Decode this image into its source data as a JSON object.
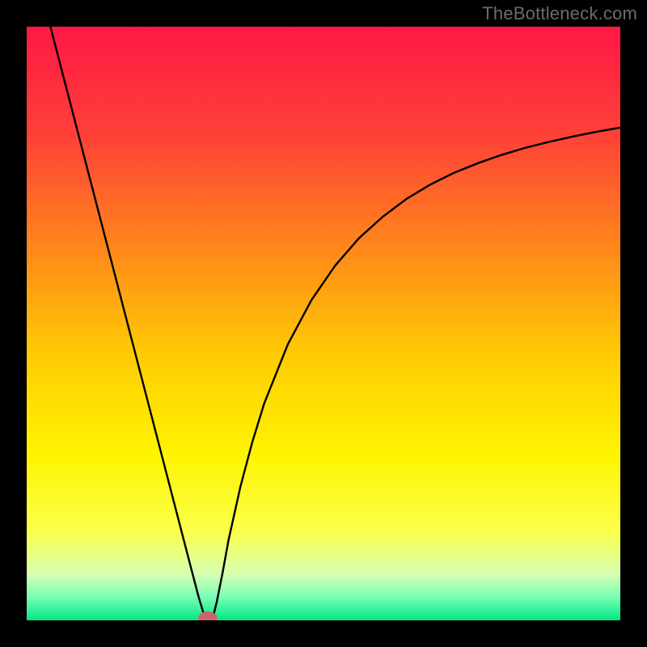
{
  "watermark": "TheBottleneck.com",
  "chart_data": {
    "type": "line",
    "title": "",
    "xlabel": "",
    "ylabel": "",
    "xlim": [
      0,
      100
    ],
    "ylim": [
      0,
      100
    ],
    "legend": false,
    "grid": false,
    "background_gradient_stops": [
      {
        "pct": 0,
        "color": "#ff1844"
      },
      {
        "pct": 18,
        "color": "#ff4038"
      },
      {
        "pct": 38,
        "color": "#ff8a1a"
      },
      {
        "pct": 55,
        "color": "#ffca04"
      },
      {
        "pct": 72,
        "color": "#fff400"
      },
      {
        "pct": 85,
        "color": "#fbff4a"
      },
      {
        "pct": 92,
        "color": "#d9ffb0"
      },
      {
        "pct": 96,
        "color": "#7cffb6"
      },
      {
        "pct": 100,
        "color": "#00e884"
      }
    ],
    "series": [
      {
        "name": "bottleneck-curve",
        "color": "#000000",
        "x": [
          4.0,
          6.0,
          8.0,
          10.0,
          12.0,
          14.0,
          16.0,
          18.0,
          20.0,
          22.0,
          24.0,
          26.0,
          28.0,
          29.0,
          30.0,
          30.5,
          31.0,
          31.5,
          32.0,
          33.0,
          34.0,
          36.0,
          38.0,
          40.0,
          44.0,
          48.0,
          52.0,
          56.0,
          60.0,
          64.0,
          68.0,
          72.0,
          76.0,
          80.0,
          84.0,
          88.0,
          92.0,
          96.0,
          100.0
        ],
        "y": [
          100.0,
          92.3,
          84.6,
          76.9,
          69.2,
          61.5,
          53.8,
          46.1,
          38.4,
          30.7,
          23.0,
          15.3,
          7.6,
          3.8,
          0.5,
          0.2,
          0.2,
          1.0,
          3.0,
          8.0,
          13.5,
          22.5,
          30.0,
          36.5,
          46.5,
          54.0,
          59.8,
          64.4,
          68.0,
          71.0,
          73.4,
          75.4,
          77.0,
          78.4,
          79.6,
          80.6,
          81.5,
          82.3,
          83.0
        ]
      }
    ],
    "marker": {
      "x": 30.5,
      "y": 0.4,
      "color": "#cc6666",
      "rx": 1.6,
      "ry": 1.1
    }
  }
}
